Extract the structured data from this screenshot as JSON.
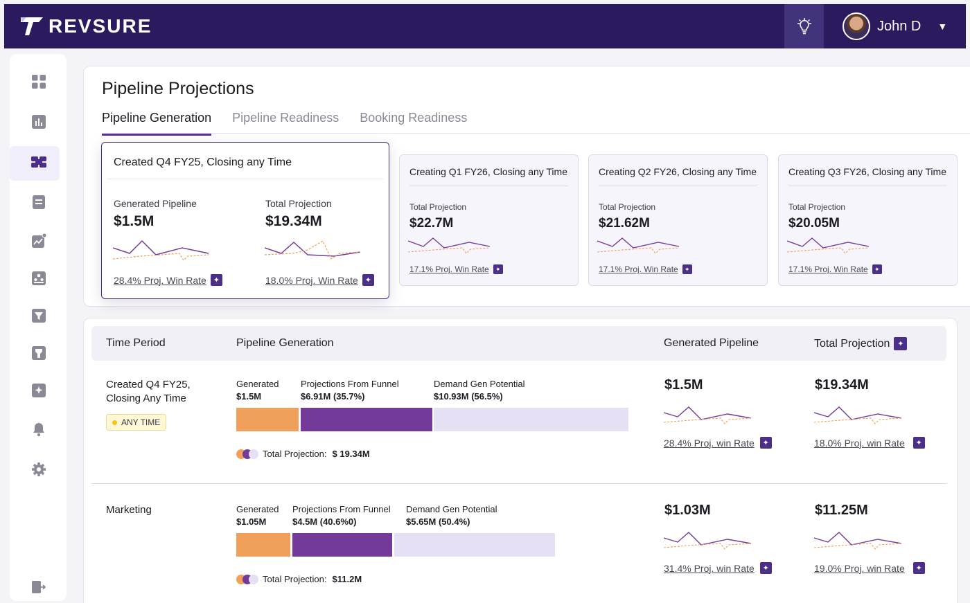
{
  "app": {
    "brand": "REVSURE",
    "user_name": "John D"
  },
  "colors": {
    "header": "#2c1a5e",
    "accent": "#4b2d8a",
    "generated": "#f0a05a",
    "funnel": "#733a9a",
    "demand": "#e6e0f5"
  },
  "sidebar": {
    "items": [
      "dashboard-icon",
      "chart-icon",
      "pipeline-icon",
      "document-icon",
      "trend-icon",
      "accounts-icon",
      "funnel-icon",
      "filter-icon",
      "ai-icon",
      "bell-icon",
      "gear-icon"
    ],
    "bottom": "logout-icon"
  },
  "page": {
    "title": "Pipeline Projections",
    "tabs": [
      "Pipeline Generation",
      "Pipeline Readiness",
      "Booking Readiness"
    ]
  },
  "featured": {
    "title": "Created Q4 FY25, Closing any Time",
    "generated_label": "Generated Pipeline",
    "generated_value": "$1.5M",
    "projection_label": "Total Projection",
    "projection_value": "$19.34M",
    "generated_winrate": "28.4% Proj. Win Rate",
    "projection_winrate": "18.0% Proj. Win Rate"
  },
  "cards": [
    {
      "title": "Creating Q1 FY26, Closing any Time",
      "label": "Total Projection",
      "value": "$22.7M",
      "winrate": "17.1% Proj. Win Rate"
    },
    {
      "title": "Creating Q2 FY26, Closing any Time",
      "label": "Total Projection",
      "value": "$21.62M",
      "winrate": "17.1% Proj. Win Rate"
    },
    {
      "title": "Creating Q3 FY26, Closing any Time",
      "label": "Total Projection",
      "value": "$20.05M",
      "winrate": "17.1% Proj. Win Rate"
    }
  ],
  "table": {
    "headers": [
      "Time Period",
      "Pipeline Generation",
      "Generated Pipeline",
      "Total Projection"
    ],
    "rows": [
      {
        "period": "Created Q4 FY25,\nClosing Any Time",
        "badge": "ANY TIME",
        "segments": [
          {
            "label": "Generated",
            "value": "$1.5M",
            "percent": null
          },
          {
            "label": "Projections From Funnel",
            "value": "$6.91M (35.7%)",
            "percent": 35.7
          },
          {
            "label": "Demand Gen Potential",
            "value": "$10.93M (56.5%)",
            "percent": 56.5
          }
        ],
        "total_label": "Total Projection:",
        "total_value": "$ 19.34M",
        "generated_value": "$1.5M",
        "generated_winrate": "28.4% Proj. win Rate",
        "projection_value": "$19.34M",
        "projection_winrate": "18.0% Proj. win Rate"
      },
      {
        "period": "Marketing",
        "badge": "",
        "segments": [
          {
            "label": "Generated",
            "value": "$1.05M",
            "percent": null
          },
          {
            "label": "Projections From Funnel",
            "value": "$4.5M (40.6%0)",
            "percent": 40.6
          },
          {
            "label": "Demand Gen Potential",
            "value": "$5.65M (50.4%)",
            "percent": 50.4
          }
        ],
        "total_label": "Total Projection:",
        "total_value": "$11.2M",
        "generated_value": "$1.03M",
        "generated_winrate": "31.4% Proj. win Rate",
        "projection_value": "$11.25M",
        "projection_winrate": "19.0% Proj. win Rate"
      }
    ]
  }
}
